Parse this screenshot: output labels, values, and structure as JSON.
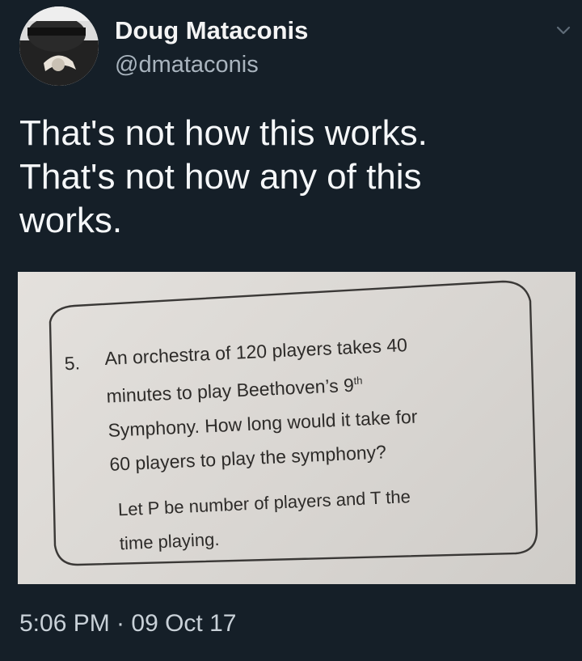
{
  "author": {
    "display_name": "Doug Mataconis",
    "handle": "@dmataconis"
  },
  "tweet": {
    "text_lines": [
      "That's not how this works.",
      "That's not how any of this",
      "works."
    ],
    "timestamp": "5:06 PM · 09 Oct 17"
  },
  "media": {
    "question_number": "5.",
    "question_lines": [
      "An orchestra of 120 players takes 40",
      "minutes to play Beethoven’s 9",
      "Symphony. How long would it take for",
      "60 players to play the symphony?"
    ],
    "superscript": "th",
    "note_lines": [
      "Let P be number of players and T the",
      "time playing."
    ]
  },
  "icons": {
    "menu": "chevron-down-icon",
    "avatar": "avatar"
  },
  "colors": {
    "background": "#151f28",
    "handle": "#a9b4be",
    "text": "#f5f7f9",
    "paper": "#e4e1dd"
  }
}
